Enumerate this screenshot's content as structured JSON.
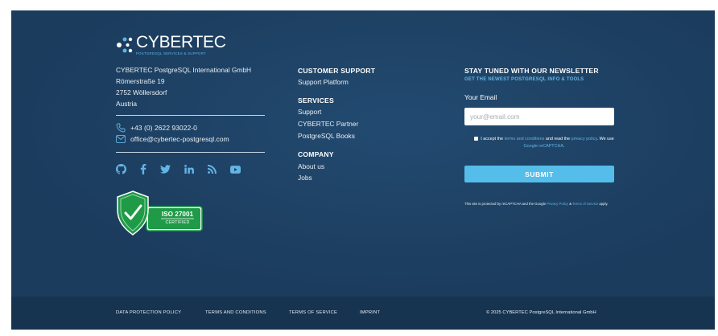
{
  "brand": {
    "name": "CYBERTEC",
    "tagline": "POSTGRESQL SERVICES & SUPPORT"
  },
  "company": {
    "lines": [
      "CYBERTEC PostgreSQL International GmbH",
      "Römerstraße 19",
      "2752 Wöllersdorf",
      "Austria"
    ],
    "phone": "+43 (0) 2622 93022-0",
    "email": "office@cybertec-postgresql.com"
  },
  "social": [
    "github-icon",
    "facebook-icon",
    "twitter-icon",
    "linkedin-icon",
    "rss-icon",
    "youtube-icon"
  ],
  "iso_badge": {
    "title": "ISO 27001",
    "subtitle": "CERTIFIED"
  },
  "customer_support": {
    "title": "CUSTOMER SUPPORT",
    "links": [
      "Support Platform"
    ]
  },
  "services": {
    "title": "SERVICES",
    "links": [
      "Support",
      "CYBERTEC Partner",
      "PostgreSQL Books"
    ]
  },
  "company_nav": {
    "title": "COMPANY",
    "links": [
      "About us",
      "Jobs"
    ]
  },
  "newsletter": {
    "title": "STAY TUNED WITH OUR NEWSLETTER",
    "subtitle": "GET THE NEWEST POSTGRESQL INFO & TOOLS",
    "email_label": "Your Email",
    "email_placeholder": "your@email.com",
    "consent_prefix": "I accept the",
    "consent_terms": "terms and conditions",
    "consent_mid": "and read the",
    "consent_privacy": "privacy policy",
    "consent_suffix": ". We use",
    "consent_recaptcha": "Google reCAPTCHA",
    "consent_end": ".",
    "submit_label": "SUBMIT",
    "recaptcha_prefix": "This site is protected by reCAPTCHA and the Google",
    "recaptcha_privacy": "Privacy Policy",
    "recaptcha_and": "&",
    "recaptcha_terms": "Terms of Service",
    "recaptcha_suffix": "apply."
  },
  "bottom": {
    "links": [
      "DATA PROTECTION POLICY",
      "TERMS AND CONDITIONS",
      "TERMS OF SERVICE",
      "IMPRINT"
    ],
    "copyright": "© 2025 CYBERTEC PostgreSQL International GmbH"
  },
  "colors": {
    "background": "#1b3c5d",
    "bottom_bar": "#163350",
    "accent": "#55bde9",
    "link_blue": "#63b4e5",
    "iso_green": "#1f9b48"
  }
}
